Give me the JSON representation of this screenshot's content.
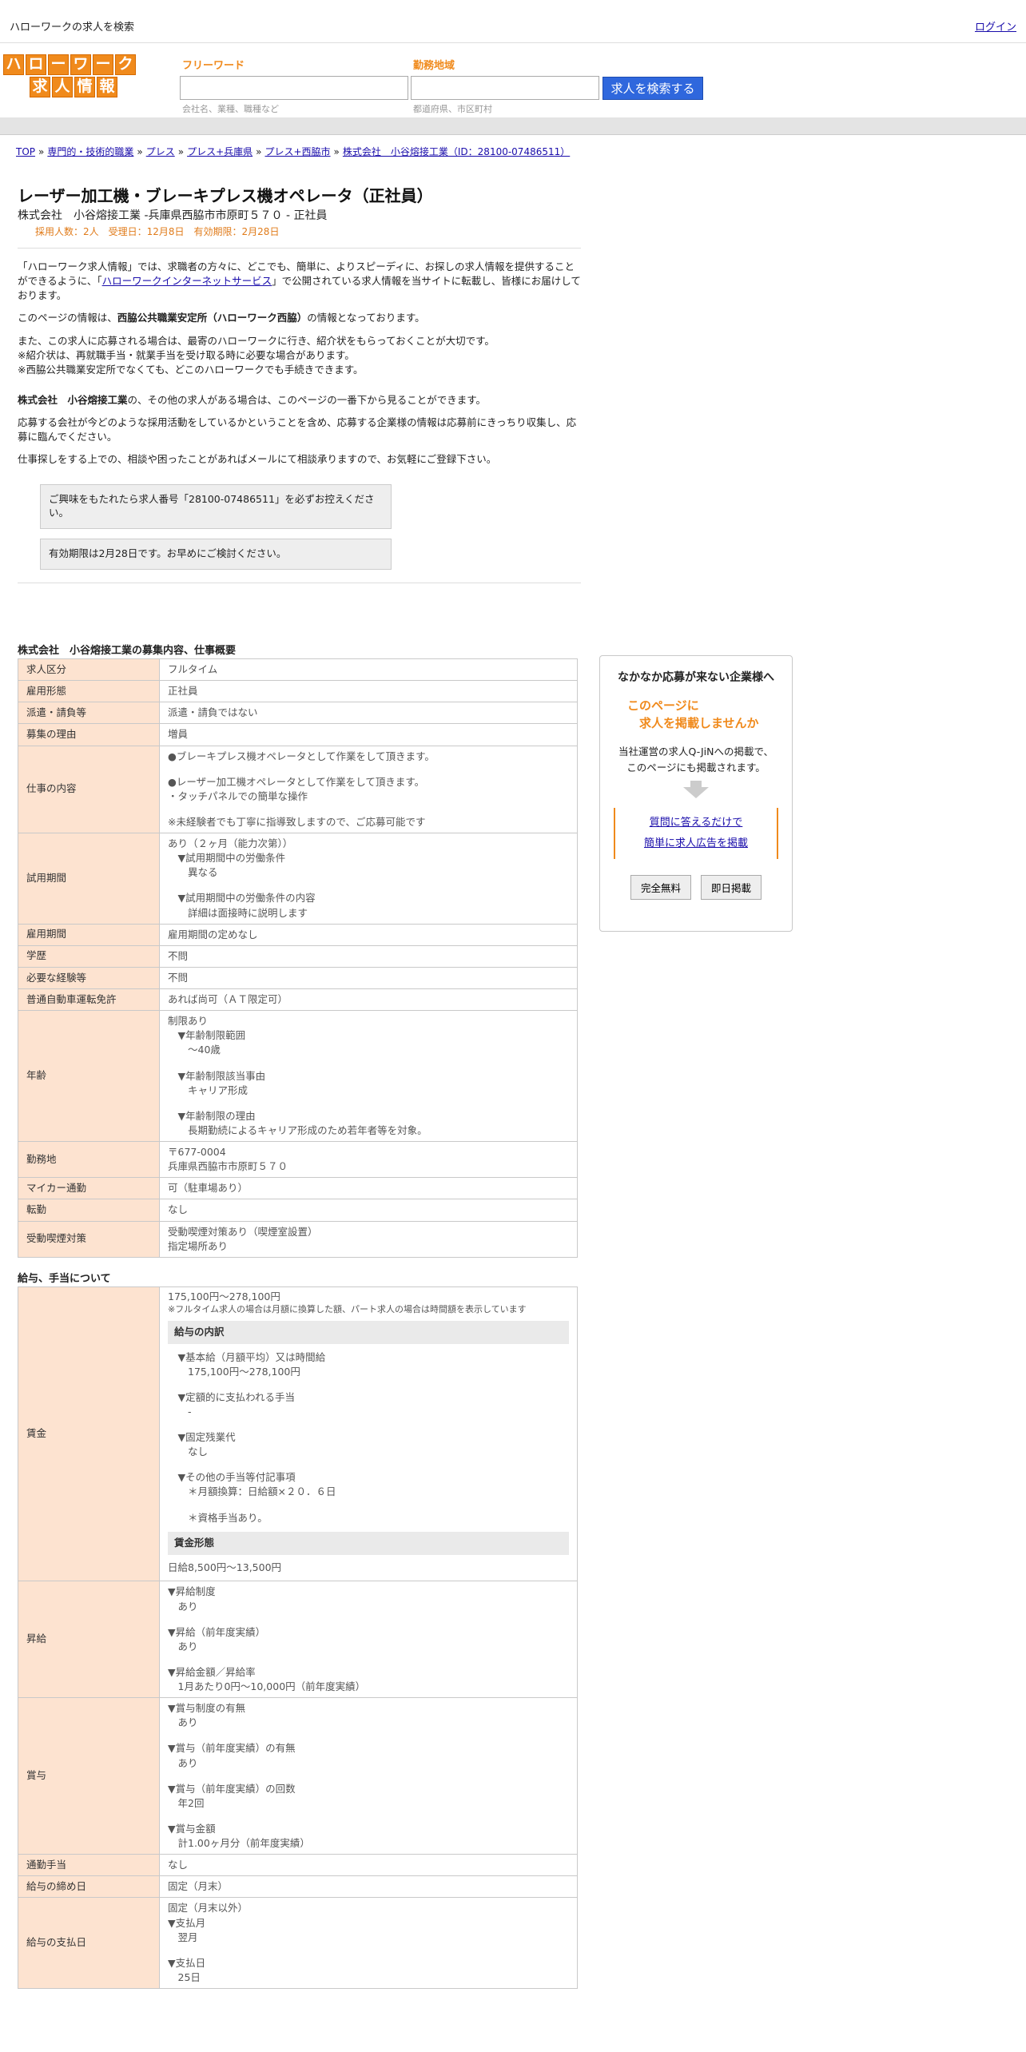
{
  "topbar": {
    "title": "ハローワークの求人を検索",
    "login": "ログイン"
  },
  "logo": {
    "row1": [
      "ハ",
      "ロ",
      "ー",
      "ワ",
      "ー",
      "ク"
    ],
    "row2": [
      "求",
      "人",
      "情",
      "報"
    ]
  },
  "search": {
    "freeword_label": "フリーワード",
    "freeword_placeholder": "会社名、業種、職種など",
    "area_label": "勤務地域",
    "area_placeholder": "都道府県、市区町村",
    "button": "求人を検索する"
  },
  "breadcrumb": [
    "TOP",
    "専門的・技術的職業",
    "プレス",
    "プレス+兵庫県",
    "プレス+西脇市",
    "株式会社　小谷熔接工業（ID：28100-07486511）"
  ],
  "job": {
    "title": "レーザー加工機・ブレーキプレス機オペレータ（正社員）",
    "company_line": "株式会社　小谷熔接工業 -兵庫県西脇市市原町５７０ - 正社員",
    "meta": "採用人数：2人　受理日：12月8日　有効期限：2月28日"
  },
  "intro": {
    "p1_a": "「ハローワーク求人情報」では、求職者の方々に、どこでも、簡単に、よりスピーディに、お探しの求人情報を提供することができるように、「",
    "p1_link": "ハローワークインターネットサービス",
    "p1_b": "」で公開されている求人情報を当サイトに転載し、皆様にお届けしております。",
    "p2_a": "このページの情報は、",
    "p2_bold": "西脇公共職業安定所（ハローワーク西脇）",
    "p2_b": "の情報となっております。",
    "p3_1": "また、この求人に応募される場合は、最寄のハローワークに行き、紹介状をもらっておくことが大切です。",
    "p3_2": "※紹介状は、再就職手当・就業手当を受け取る時に必要な場合があります。",
    "p3_3": "※西脇公共職業安定所でなくても、どこのハローワークでも手続きできます。",
    "p4_bold": "株式会社　小谷熔接工業",
    "p4": "の、その他の求人がある場合は、このページの一番下から見ることができます。",
    "p5": "応募する会社が今どのような採用活動をしているかということを含め、応募する企業様の情報は応募前にきっちり収集し、応募に臨んでください。",
    "p6": "仕事探しをする上での、相談や困ったことがあればメールにて相談承りますので、お気軽にご登録下さい。",
    "notice1": "ご興味をもたれたら求人番号「28100-07486511」を必ずお控えください。",
    "notice2": "有効期限は2月28日です。お早めにご検討ください。"
  },
  "summary": {
    "title": "株式会社　小谷熔接工業の募集内容、仕事概要",
    "rows": [
      {
        "label": "求人区分",
        "lines": [
          "フルタイム"
        ]
      },
      {
        "label": "雇用形態",
        "lines": [
          "正社員"
        ]
      },
      {
        "label": "派遣・請負等",
        "lines": [
          "派遣・請負ではない"
        ]
      },
      {
        "label": "募集の理由",
        "lines": [
          "増員"
        ]
      },
      {
        "label": "仕事の内容",
        "lines": [
          "●ブレーキプレス機オペレータとして作業をして頂きます。",
          "",
          "●レーザー加工機オペレータとして作業をして頂きます。",
          "・タッチパネルでの簡単な操作",
          "",
          "※未経験者でも丁寧に指導致しますので、ご応募可能です"
        ]
      },
      {
        "label": "試用期間",
        "lines": [
          "あり（２ヶ月（能力次第））",
          "　▼試用期間中の労働条件",
          "　　異なる",
          "",
          "　▼試用期間中の労働条件の内容",
          "　　詳細は面接時に説明します"
        ]
      },
      {
        "label": "雇用期間",
        "lines": [
          "雇用期間の定めなし"
        ]
      },
      {
        "label": "学歴",
        "lines": [
          "不問"
        ]
      },
      {
        "label": "必要な経験等",
        "lines": [
          "不問"
        ]
      },
      {
        "label": "普通自動車運転免許",
        "lines": [
          "あれば尚可（ＡＴ限定可）"
        ]
      },
      {
        "label": "年齢",
        "lines": [
          "制限あり",
          "　▼年齢制限範囲",
          "　　〜40歳",
          "",
          "　▼年齢制限該当事由",
          "　　キャリア形成",
          "",
          "　▼年齢制限の理由",
          "　　長期勤続によるキャリア形成のため若年者等を対象。"
        ]
      },
      {
        "label": "勤務地",
        "lines": [
          "〒677-0004",
          "兵庫県西脇市市原町５７０"
        ]
      },
      {
        "label": "マイカー通勤",
        "lines": [
          "可（駐車場あり）"
        ]
      },
      {
        "label": "転勤",
        "lines": [
          "なし"
        ]
      },
      {
        "label": "受動喫煙対策",
        "lines": [
          "受動喫煙対策あり（喫煙室設置）",
          "指定場所あり"
        ]
      }
    ]
  },
  "pay": {
    "title": "給与、手当について",
    "wage_label": "賃金",
    "wage_range": "175,100円〜278,100円",
    "wage_note": "※フルタイム求人の場合は月額に換算した額、パート求人の場合は時間額を表示しています",
    "breakdown_title": "給与の内訳",
    "breakdown_lines": [
      "　▼基本給（月額平均）又は時間給",
      "　　175,100円〜278,100円",
      "",
      "　▼定額的に支払われる手当",
      "　　-",
      "",
      "　▼固定残業代",
      "　　なし",
      "",
      "　▼その他の手当等付記事項",
      "　　＊月額換算：日給額×２０．６日",
      "",
      "　　＊資格手当あり。"
    ],
    "form_title": "賃金形態",
    "form_value": "日給8,500円〜13,500円",
    "rows": [
      {
        "label": "昇給",
        "lines": [
          "▼昇給制度",
          "　あり",
          "",
          "▼昇給（前年度実績）",
          "　あり",
          "",
          "▼昇給金額／昇給率",
          "　1月あたり0円〜10,000円（前年度実績）"
        ]
      },
      {
        "label": "賞与",
        "lines": [
          "▼賞与制度の有無",
          "　あり",
          "",
          "▼賞与（前年度実績）の有無",
          "　あり",
          "",
          "▼賞与（前年度実績）の回数",
          "　年2回",
          "",
          "▼賞与金額",
          "　計1.00ヶ月分（前年度実績）"
        ]
      },
      {
        "label": "通勤手当",
        "lines": [
          "なし"
        ]
      },
      {
        "label": "給与の締め日",
        "lines": [
          "固定（月末）"
        ]
      },
      {
        "label": "給与の支払日",
        "lines": [
          "固定（月末以外）",
          "▼支払月",
          "　翌月",
          "",
          "▼支払日",
          "　25日"
        ]
      }
    ]
  },
  "ad": {
    "title": "なかなか応募が来ない企業様へ",
    "orange_1": "このページに",
    "orange_2": "　求人を掲載しませんか",
    "text_1": "当社運営の求人Q-JiNへの掲載で、",
    "text_2": "このページにも掲載されます。",
    "link_1": "質問に答えるだけで",
    "link_2": "簡単に求人広告を掲載",
    "btn_1": "完全無料",
    "btn_2": "即日掲載"
  }
}
